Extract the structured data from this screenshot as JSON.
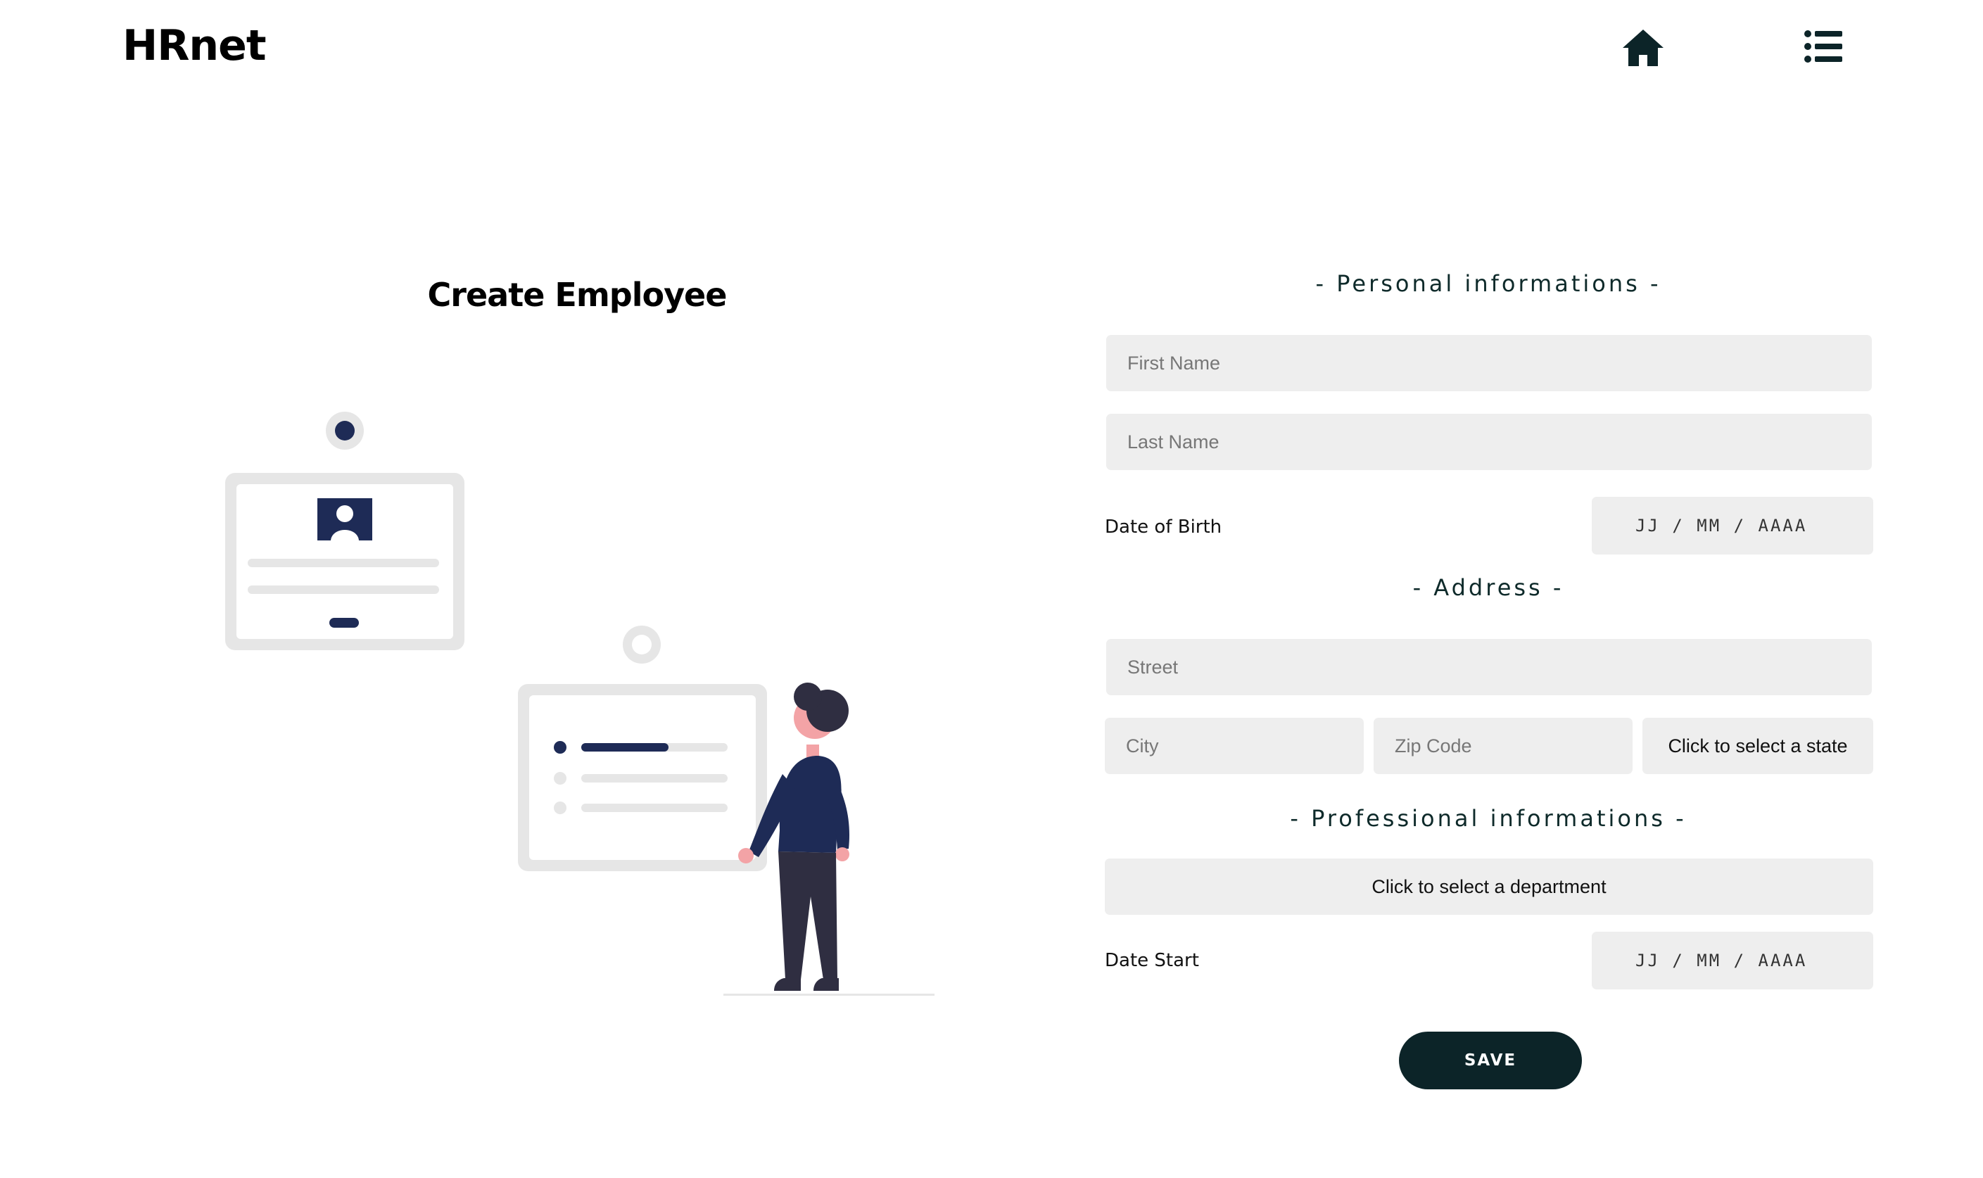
{
  "header": {
    "logo": "HRnet",
    "nav": {
      "home_icon": "home-icon",
      "list_icon": "list-icon"
    }
  },
  "page": {
    "title": "Create Employee"
  },
  "form": {
    "personal": {
      "title": "- Personal informations -",
      "first_name": {
        "placeholder": "First Name",
        "value": ""
      },
      "last_name": {
        "placeholder": "Last Name",
        "value": ""
      },
      "date_of_birth": {
        "label": "Date of Birth",
        "placeholder": "JJ / MM / AAAA"
      }
    },
    "address": {
      "title": "- Address -",
      "street": {
        "placeholder": "Street",
        "value": ""
      },
      "city": {
        "placeholder": "City",
        "value": ""
      },
      "zip": {
        "placeholder": "Zip Code",
        "value": ""
      },
      "state": {
        "placeholder": "Click to select a state"
      }
    },
    "professional": {
      "title": "- Professional informations -",
      "department": {
        "placeholder": "Click to select a department"
      },
      "date_start": {
        "label": "Date Start",
        "placeholder": "JJ / MM / AAAA"
      }
    },
    "save_label": "SAVE"
  },
  "colors": {
    "accent": "#0c2428",
    "field_bg": "#eeeeee",
    "illustration_navy": "#1e2b56",
    "illustration_gray": "#e6e6e6"
  }
}
